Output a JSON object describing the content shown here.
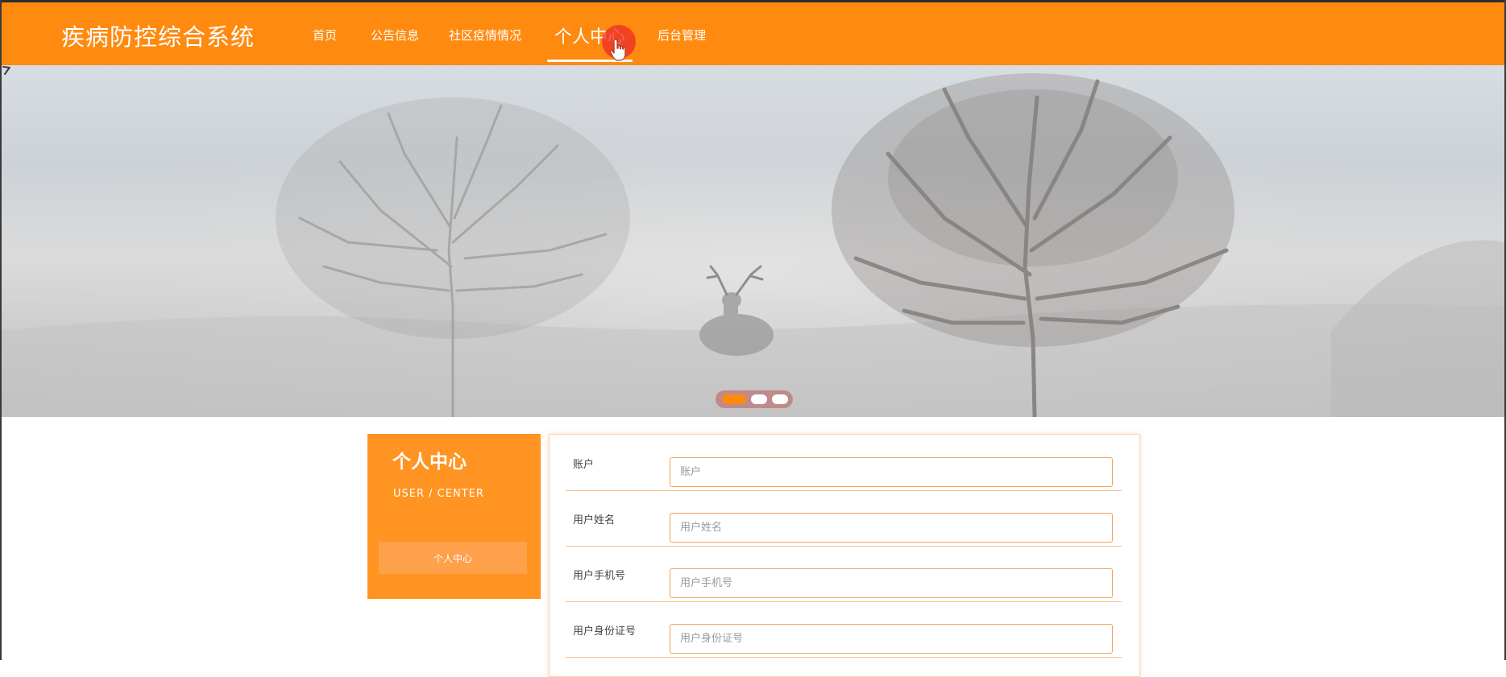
{
  "header": {
    "brand": "疾病防控综合系统",
    "nav": [
      "首页",
      "公告信息",
      "社区疫情情况",
      "个人中心",
      "后台管理"
    ],
    "active_index": 3,
    "colors": {
      "accent": "#ff8a10"
    }
  },
  "banner": {
    "slide_count": 3,
    "active_slide": 0
  },
  "side_panel": {
    "title": "个人中心",
    "subtitle": "USER / CENTER",
    "button_label": "个人中心"
  },
  "form": {
    "rows": [
      {
        "label": "账户",
        "placeholder": "账户",
        "value": ""
      },
      {
        "label": "用户姓名",
        "placeholder": "用户姓名",
        "value": ""
      },
      {
        "label": "用户手机号",
        "placeholder": "用户手机号",
        "value": ""
      },
      {
        "label": "用户身份证号",
        "placeholder": "用户身份证号",
        "value": ""
      }
    ]
  }
}
